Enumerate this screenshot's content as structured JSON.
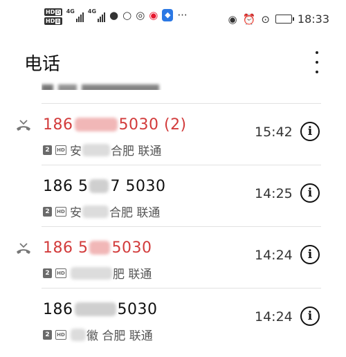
{
  "status_bar": {
    "hd_labels": [
      "HD",
      "HD"
    ],
    "hd_sub": [
      "D",
      "B"
    ],
    "signal_labels": [
      "4G",
      "4G"
    ],
    "time": "18:33",
    "more_icons": "···"
  },
  "app_bar": {
    "title": "电话"
  },
  "calls": [
    {
      "missed": true,
      "number_prefix": "186",
      "number_suffix": "5030 (2)",
      "sim": "2",
      "hd": "HD",
      "location_prefix": "安",
      "location_suffix": "合肥 联通",
      "time": "15:42"
    },
    {
      "missed": false,
      "number_prefix": "186 5",
      "number_suffix": "7 5030",
      "sim": "2",
      "hd": "HD",
      "location_prefix": "安",
      "location_suffix": "合肥 联通",
      "time": "14:25"
    },
    {
      "missed": true,
      "number_prefix": "186 5",
      "number_suffix": "5030",
      "sim": "2",
      "hd": "HD",
      "location_prefix": "",
      "location_suffix": "肥 联通",
      "time": "14:24"
    },
    {
      "missed": false,
      "number_prefix": "186",
      "number_suffix": "5030",
      "sim": "2",
      "hd": "HD",
      "location_prefix": "",
      "location_suffix": "徽 合肥 联通",
      "time": "14:24"
    }
  ],
  "colors": {
    "missed": "#d23b3b",
    "normal": "#111111",
    "secondary": "#555555",
    "divider": "#e2e2e2"
  },
  "icons": {
    "missed_call": "missed-call-icon",
    "info": "info-icon",
    "more": "more-vert-icon"
  },
  "info_glyph": "i"
}
